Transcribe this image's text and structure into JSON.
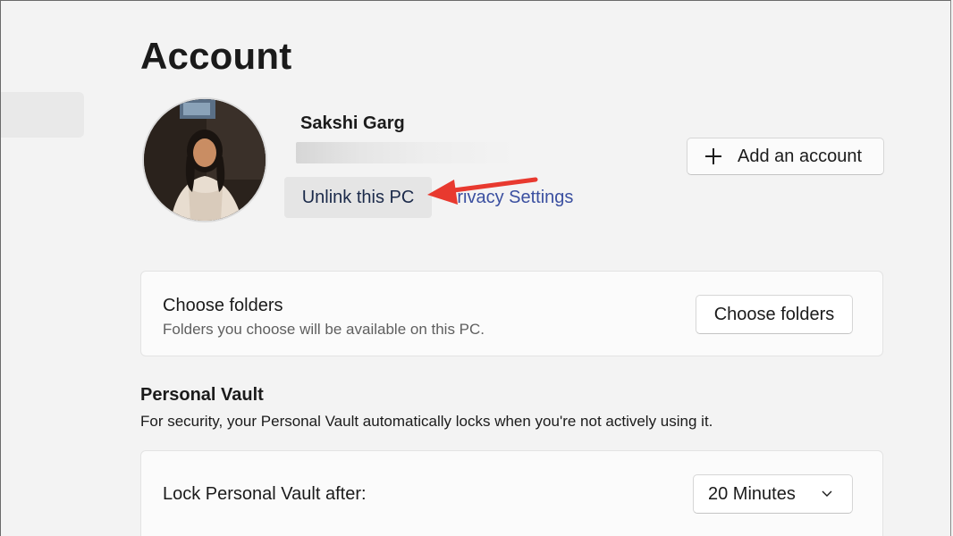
{
  "page": {
    "title": "Account"
  },
  "account": {
    "name": "Sakshi Garg",
    "unlink_label": "Unlink this PC",
    "privacy_label": "Privacy Settings",
    "add_account_label": "Add an account"
  },
  "folders_card": {
    "title": "Choose folders",
    "subtitle": "Folders you choose will be available on this PC.",
    "button_label": "Choose folders"
  },
  "personal_vault": {
    "title": "Personal Vault",
    "description": "For security, your Personal Vault automatically locks when you're not actively using it.",
    "lock_label": "Lock Personal Vault after:",
    "lock_value": "20 Minutes"
  },
  "colors": {
    "background": "#f3f3f3",
    "card": "#fbfbfb",
    "link": "#3a4fa0",
    "annotation_arrow": "#e8392f"
  },
  "icons": {
    "add": "plus-icon",
    "dropdown": "chevron-down-icon"
  }
}
